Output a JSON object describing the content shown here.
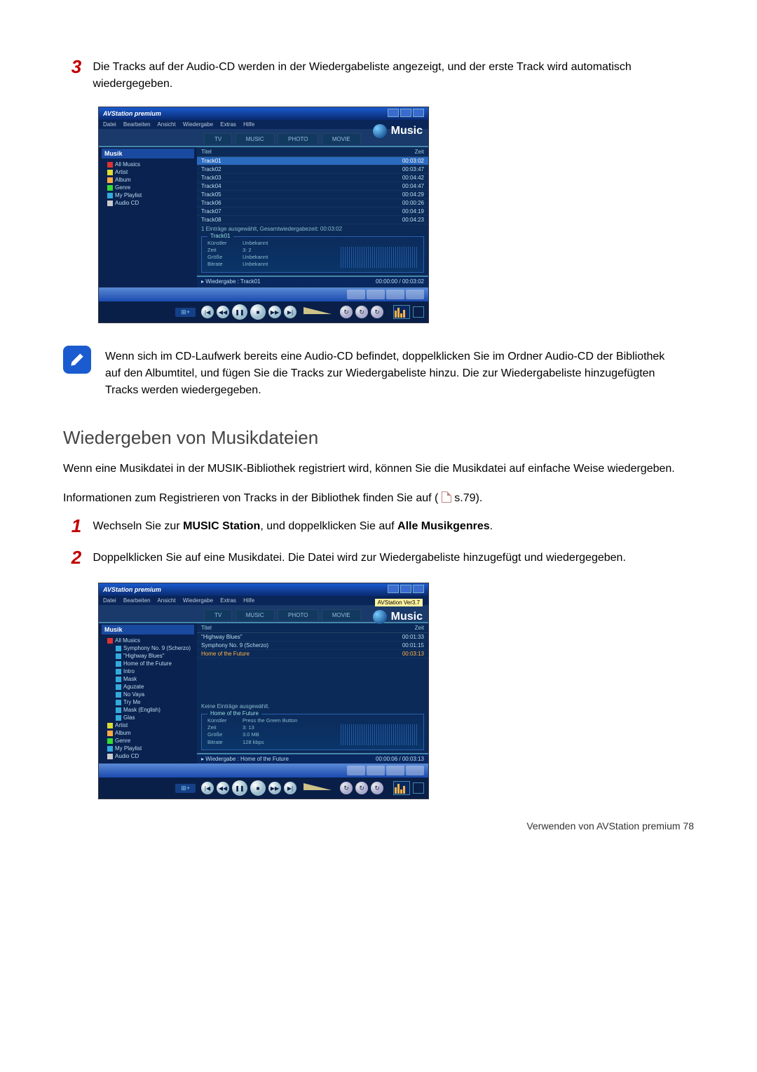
{
  "step3": {
    "num": "3",
    "text": "Die Tracks auf der Audio-CD werden in der Wiedergabeliste angezeigt, und der erste Track wird automatisch wiedergegeben."
  },
  "note": {
    "text": "Wenn sich im CD-Laufwerk bereits eine Audio-CD befindet, doppelklicken Sie im Ordner Audio-CD der Bibliothek auf den Albumtitel, und fügen Sie die Tracks zur Wiedergabeliste hinzu. Die zur Wiedergabeliste hinzugefügten Tracks werden wiedergegeben."
  },
  "section_h2": "Wiedergeben von Musikdateien",
  "section_p1": "Wenn eine Musikdatei in der MUSIK-Bibliothek registriert wird, können Sie die Musikdatei auf einfache Weise wiedergeben.",
  "section_p2_a": "Informationen zum Registrieren von Tracks in der Bibliothek finden Sie auf (",
  "section_p2_b": " s.79).",
  "step1": {
    "num": "1",
    "text_a": "Wechseln Sie zur ",
    "bold_a": "MUSIC Station",
    "text_b": ", und doppelklicken Sie auf ",
    "bold_b": "Alle Musikgenres",
    "text_c": "."
  },
  "step2": {
    "num": "2",
    "text": "Doppelklicken Sie auf eine Musikdatei. Die Datei wird zur Wiedergabeliste hinzugefügt und wiedergegeben."
  },
  "footer": "Verwenden von AVStation premium   78",
  "app": {
    "title": "AVStation premium",
    "brand": "Music",
    "version_badge": "AVStation Ver3.7",
    "menu": [
      "Datei",
      "Bearbeiten",
      "Ansicht",
      "Wiedergabe",
      "Extras",
      "Hilfe"
    ],
    "tabs": [
      "TV",
      "MUSIC",
      "PHOTO",
      "MOVIE"
    ],
    "side_header": "Musik",
    "side_items_1": [
      "All Musics",
      "Artist",
      "Album",
      "Genre",
      "My Playlist",
      "Audio CD"
    ],
    "side_tree_2": {
      "root": "All Musics",
      "children": [
        "Symphony No. 9 (Scherzo)",
        "\"Highway Blues\"",
        "Home of the Future",
        "Intro",
        "Mask",
        "Aguzate",
        "No Vaya",
        "Try Me",
        "Mask (English)",
        "Glas"
      ],
      "rest": [
        "Artist",
        "Album",
        "Genre",
        "My Playlist",
        "Audio CD"
      ]
    },
    "list_header": {
      "col1": "Titel",
      "col2": "Zeit"
    },
    "s1_rows": [
      {
        "t": "Track01",
        "z": "00:03:02",
        "sel": true
      },
      {
        "t": "Track02",
        "z": "00:03:47"
      },
      {
        "t": "Track03",
        "z": "00:04:42"
      },
      {
        "t": "Track04",
        "z": "00:04:47"
      },
      {
        "t": "Track05",
        "z": "00:04:29"
      },
      {
        "t": "Track06",
        "z": "00:00:26"
      },
      {
        "t": "Track07",
        "z": "00:04:19"
      },
      {
        "t": "Track08",
        "z": "00:04:23"
      }
    ],
    "s1_summary": "1 Einträge ausgewählt, Gesamtwiedergabezeit: 00:03:02",
    "s1_info": {
      "hdr": "Track01",
      "k": [
        "Künstler",
        "Zeit",
        "Größe",
        "Bitrate"
      ],
      "v": [
        "Unbekannt",
        "3:  2",
        "Unbekannt",
        "Unbekannt"
      ]
    },
    "s1_play": {
      "title": "Wiedergabe : Track01",
      "time": "00:00:00 / 00:03:02"
    },
    "s2_rows": [
      {
        "t": "\"Highway Blues\"",
        "z": "00:01:33"
      },
      {
        "t": "Symphony No. 9 (Scherzo)",
        "z": "00:01:15"
      },
      {
        "t": "Home of the Future",
        "z": "00:03:13",
        "hi": true
      }
    ],
    "s2_summary": "Keine Einträge ausgewählt.",
    "s2_info": {
      "hdr": "Home of the Future",
      "k": [
        "Künstler",
        "Zeit",
        "Größe",
        "Bitrate"
      ],
      "v": [
        "Press the Green Button",
        "3: 13",
        "3.0 MB",
        "128 kbps"
      ]
    },
    "s2_play": {
      "title": "Wiedergabe : Home of the Future",
      "time": "00:00:06 / 00:03:13"
    },
    "add_btn": "⊞+"
  }
}
